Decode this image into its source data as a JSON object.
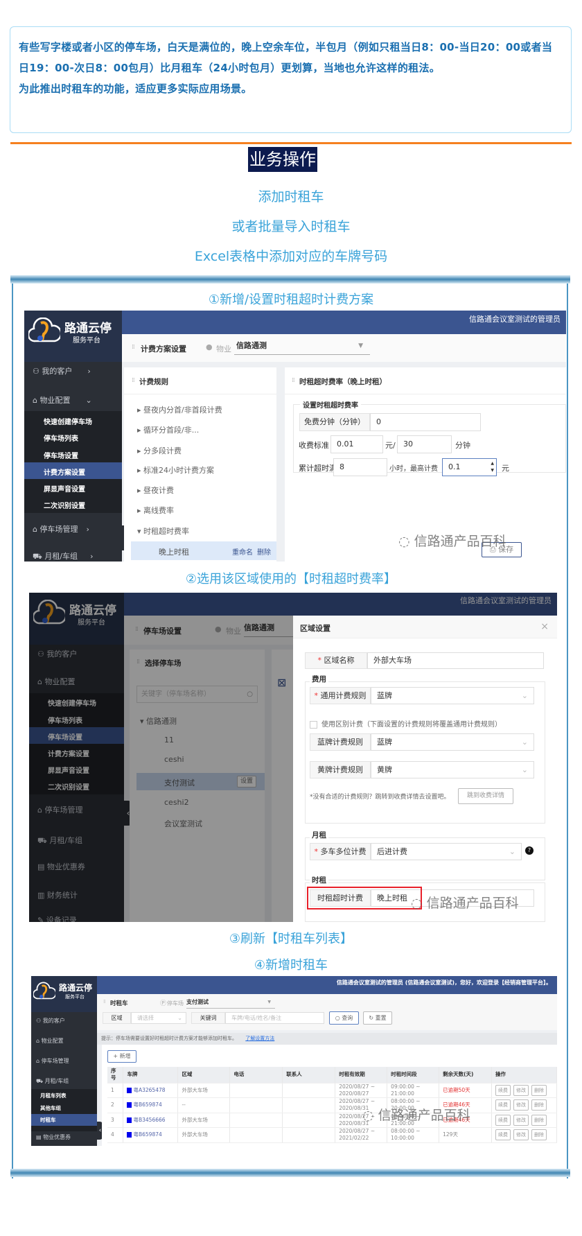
{
  "intro": {
    "paragraph1": "有些写字楼或者小区的停车场，白天是满位的，晚上空余车位，半包月（例如只租当日8：00-当日20：00或者当日19：00-次日8：00包月）比月租车（24小时包月）更划算，当地也允许这样的租法。",
    "paragraph2": "为此推出时租车的功能，适应更多实际应用场景。"
  },
  "section_title": "业务操作",
  "steps": [
    "添加时租车",
    "或者批量导入时租车",
    "Excel表格中添加对应的车牌号码"
  ],
  "captions": [
    "①新增/设置时租超时计费方案",
    "②选用该区域使用的【时租超时费率】",
    "③刷新【时租车列表】",
    "④新增时租车"
  ],
  "watermark": "信路通产品百科",
  "colors": {
    "accent": "#3aa3d9",
    "navy": "#3b5590",
    "orange": "#f5801f",
    "sidebar": "#2b2f36",
    "danger": "#e33333"
  },
  "brand": {
    "name": "路通云停",
    "sub": "服务平台"
  },
  "shot1": {
    "user": "信路通会议室测试的管理员",
    "page_title": "计费方案设置",
    "property_label": "物业",
    "property_value": "信路通测",
    "menu": {
      "customers": "我的客户",
      "property": "物业配置",
      "subs": [
        "快速创建停车场",
        "停车场列表",
        "停车场设置",
        "计费方案设置",
        "屏显声音设置",
        "二次识别设置"
      ],
      "parking": "停车场管理",
      "monthly": "月租/车组"
    },
    "rules_title": "计费规则",
    "rules": [
      "昼夜内分首/非首段计费",
      "循环分首段/非...",
      "分多段计费",
      "标准24小时计费方案",
      "昼夜计费",
      "离线费率",
      "时租超时费率"
    ],
    "active_rule": {
      "name": "晚上时租",
      "rename": "重命名",
      "delete": "删除"
    },
    "detail_title": "时租超时费率（晚上时租）",
    "legend": "设置时租超时费率",
    "free_label": "免费分钟（分钟）",
    "free_value": "0",
    "std_label": "收费标准",
    "std_amount": "0.01",
    "std_unit1": "元/",
    "std_minutes": "30",
    "std_unit2": "分钟",
    "acc_label": "累计超时满",
    "acc_hours": "8",
    "acc_mid": "小时，最高计费",
    "acc_max": "0.1",
    "acc_unit": "元",
    "save": "保存"
  },
  "shot2": {
    "user": "信路通会议室测试的管理员",
    "page_title": "停车场设置",
    "property_label": "物业",
    "property_value": "信路通测",
    "menu": {
      "customers": "我的客户",
      "property": "物业配置",
      "subs": [
        "快速创建停车场",
        "停车场列表",
        "停车场设置",
        "计费方案设置",
        "屏显声音设置",
        "二次识别设置"
      ],
      "parking": "停车场管理",
      "monthly": "月租/车组",
      "coupon": "物业优惠券",
      "finance": "财务统计",
      "device": "设备记录"
    },
    "panel_title": "选择停车场",
    "search_placeholder": "关键字（停车场名称）",
    "tree_root": "信路通测",
    "tree": [
      "11",
      "ceshi",
      "支付测试",
      "ceshi2",
      "会议室测试"
    ],
    "set_button": "设置",
    "modal": {
      "title": "区域设置",
      "area_label": "区域名称",
      "area_value": "外部大车场",
      "fee_legend": "费用",
      "general_label": "通用计费规则",
      "general_value": "蓝牌",
      "diff_checkbox": "使用区别计费（下面设置的计费规则将覆盖通用计费规则）",
      "blue_label": "蓝牌计费规则",
      "blue_value": "蓝牌",
      "yellow_label": "黄牌计费规则",
      "yellow_value": "黄牌",
      "note": "*没有合适的计费规则？跳转到收费详情去设置吧。",
      "jump_button": "跳到收费详情",
      "monthly_legend": "月租",
      "multi_label": "多车多位计费",
      "multi_value": "后进计费",
      "hourly_legend": "时租",
      "hourly_label": "时租超时计费",
      "hourly_value": "晚上时租"
    }
  },
  "shot3": {
    "user": "信路通会议室测试的管理员 (信路通会议室测试)，您好，欢迎登录【经销商管理平台】。",
    "page_title": "时租车",
    "parking_label": "停车场",
    "parking_value": "支付测试",
    "area_label": "区域",
    "area_placeholder": "请选择",
    "keyword_label": "关键词",
    "keyword_placeholder": "车牌/电话/姓名/备注",
    "search": "查询",
    "reset": "重置",
    "tip": "提示：停车场需要设置好时租超时计费方案才能够添加时租车。",
    "tip_link": "了解设置方法",
    "add": "+ 新增",
    "menu": {
      "customers": "我的客户",
      "property": "物业配置",
      "parking": "停车场管理",
      "monthly": "月租/车组",
      "subs": [
        "月租车列表",
        "其他车组",
        "时租车"
      ],
      "coupon": "物业优惠券"
    },
    "columns": [
      "序号",
      "车牌",
      "区域",
      "电话",
      "联系人",
      "时租有效期",
      "时租时间段",
      "剩余天数(天)",
      "操作"
    ],
    "actions": [
      "续费",
      "修改",
      "删除"
    ],
    "rows": [
      {
        "no": "1",
        "plate": "粤A3265478",
        "area": "外部大车场",
        "phone": "",
        "contact": "",
        "period": "2020/08/27 ~ 2020/08/27",
        "time": "09:00:00 ~ 21:00:00",
        "remain": "已逾期50天",
        "overdue": true
      },
      {
        "no": "2",
        "plate": "粤B659874",
        "area": "--",
        "phone": "",
        "contact": "",
        "period": "2020/08/27 ~ 2020/08/31",
        "time": "08:00:00 ~ 20:00:00",
        "remain": "已逾期46天",
        "overdue": true
      },
      {
        "no": "3",
        "plate": "粤B3456666",
        "area": "外部大车场",
        "phone": "",
        "contact": "",
        "period": "2020/08/27 ~ 2020/08/31",
        "time": "09:00:00 ~ 21:00:00",
        "remain": "已逾期46天",
        "overdue": true
      },
      {
        "no": "4",
        "plate": "粤B659874",
        "area": "外部大车场",
        "phone": "",
        "contact": "",
        "period": "2020/08/27 ~ 2021/02/22",
        "time": "08:00:00 ~ 10:00:00",
        "remain": "129天",
        "overdue": false
      }
    ]
  }
}
